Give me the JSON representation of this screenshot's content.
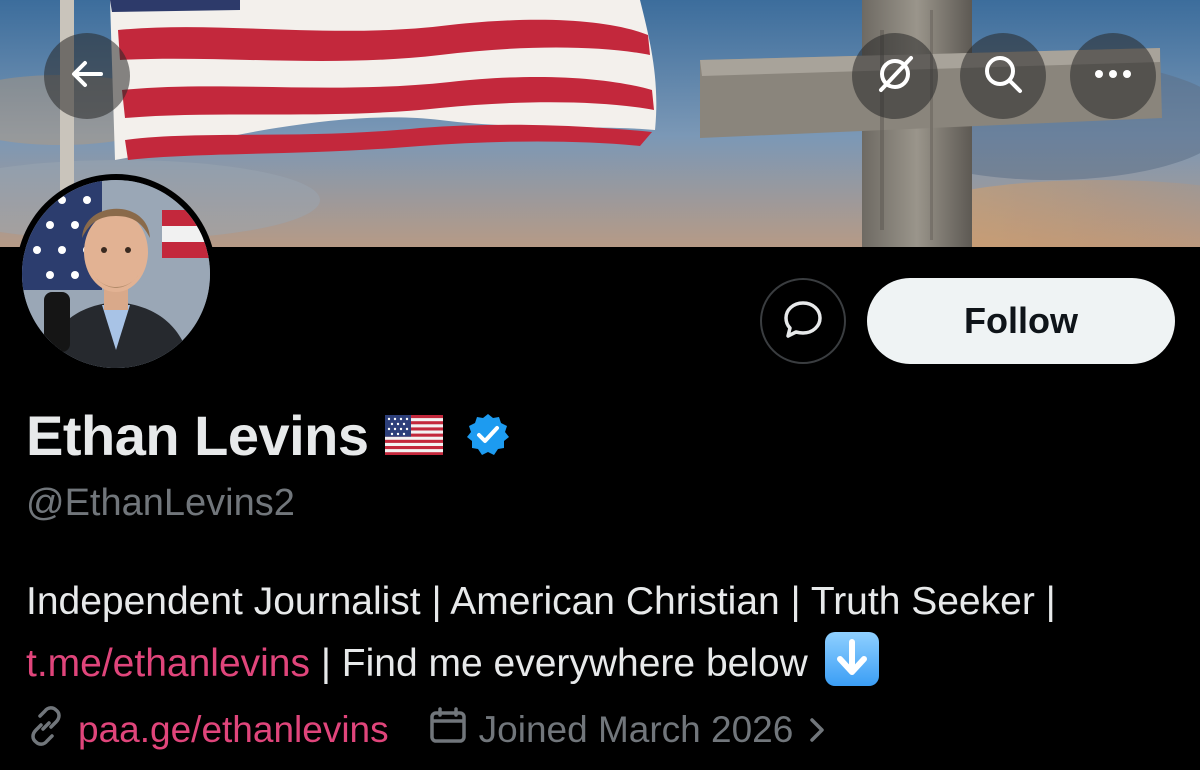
{
  "header": {
    "back_icon": "arrow-left-icon",
    "grok_icon": "grok-icon",
    "search_icon": "search-icon",
    "more_icon": "more-horizontal-icon"
  },
  "profile": {
    "display_name": "Ethan Levins",
    "name_emoji": "flag-us",
    "verified": true,
    "verified_color": "#1d9bf0",
    "handle": "@EthanLevins2",
    "bio_part1": "Independent Journalist | American Christian | Truth Seeker |",
    "bio_link": "t.me/ethanlevins",
    "bio_part2": " | Find me everywhere below ",
    "bio_emoji": "down-arrow",
    "website": "paa.ge/ethanlevins",
    "joined": "Joined March 2026",
    "link_color": "#e0457b"
  },
  "actions": {
    "message_icon": "message-bubble-icon",
    "follow_label": "Follow"
  }
}
